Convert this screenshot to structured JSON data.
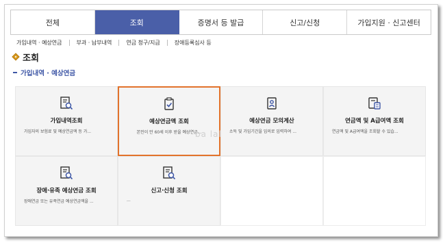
{
  "tabs": [
    {
      "label": "전체"
    },
    {
      "label": "조회"
    },
    {
      "label": "증명서 등 발급"
    },
    {
      "label": "신고/신청"
    },
    {
      "label": "가입지원 · 신고센터"
    }
  ],
  "subnav": [
    {
      "label": "가입내역 · 예상연금"
    },
    {
      "label": "부과 · 납부내역"
    },
    {
      "label": "연금 청구/지급"
    },
    {
      "label": "장애등록심사 등"
    }
  ],
  "page_title": "조회",
  "section_title": "가입내역 · 예상연금",
  "cards": [
    {
      "title": "가입내역조회",
      "desc": "가입자의 보험료 및 예상연금액 등 가...",
      "icon": "document-search-icon"
    },
    {
      "title": "예상연금액 조회",
      "desc": "본인이 만 60세 이후 받을 예상연금...",
      "icon": "clipboard-check-icon"
    },
    {
      "title": "예상연금 모의계산",
      "desc": "소득 및 가입기간을 임의로 입력하여 ...",
      "icon": "person-badge-icon"
    },
    {
      "title": "연금액 및 A급여액 조회",
      "desc": "연금액 및 A급여액을 조회할 수 있습...",
      "icon": "calculator-document-icon"
    },
    {
      "title": "장애·유족 예상연금 조회",
      "desc": "장애연금 또는 유족연금 예상연금액을 ...",
      "icon": "document-search-icon"
    },
    {
      "title": "신고·신청 조회",
      "desc": "...",
      "icon": "document-search-icon"
    }
  ],
  "watermark": "ba lal",
  "colors": {
    "active_tab": "#4a5fa8",
    "selected_border": "#e2722a",
    "section": "#3c55a5",
    "diamond": "#d99a1e"
  }
}
